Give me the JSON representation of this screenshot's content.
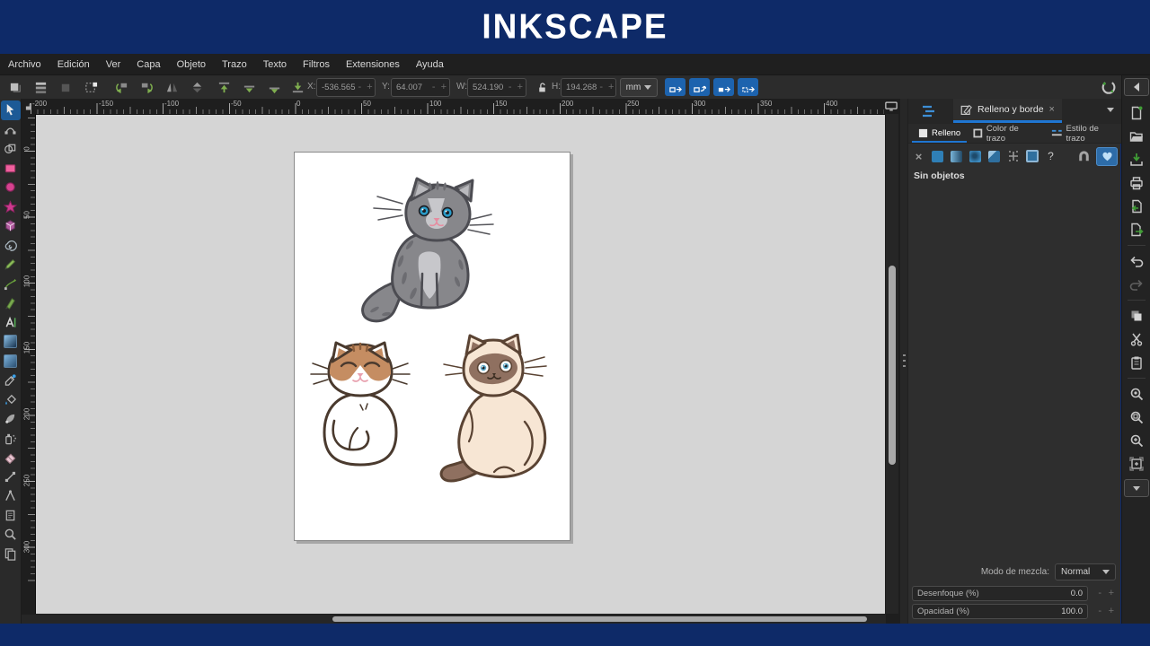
{
  "branding": {
    "logo_text": "INKSCAPE"
  },
  "menu_bar": {
    "items": [
      "Archivo",
      "Edición",
      "Ver",
      "Capa",
      "Objeto",
      "Trazo",
      "Texto",
      "Filtros",
      "Extensiones",
      "Ayuda"
    ]
  },
  "tool_controls": {
    "x_label": "X:",
    "x_value": "-536.565",
    "y_label": "Y:",
    "y_value": "64.007",
    "w_label": "W:",
    "w_value": "524.190",
    "h_label": "H:",
    "h_value": "194.268",
    "units_value": "mm",
    "minus": "-",
    "plus": "+"
  },
  "rulers": {
    "horizontal_labels": [
      "-200",
      "-150",
      "-100",
      "-50",
      "0",
      "50",
      "100",
      "150",
      "200",
      "250",
      "300",
      "350",
      "400"
    ],
    "vertical_labels": [
      "0",
      "50",
      "100",
      "150",
      "200",
      "250",
      "300"
    ]
  },
  "fill_stroke_panel": {
    "dock_tab_title": "Relleno y borde",
    "close_glyph": "×",
    "subtabs": [
      {
        "label": "Relleno"
      },
      {
        "label": "Color de trazo"
      },
      {
        "label": "Estilo de trazo"
      }
    ],
    "paint_none_glyph": "×",
    "paint_unknown_glyph": "?",
    "status_text": "Sin objetos",
    "blend_mode_label": "Modo de mezcla:",
    "blend_mode_value": "Normal",
    "blur_label": "Desenfoque (%)",
    "blur_value": "0.0",
    "opacity_label": "Opacidad (%)",
    "opacity_value": "100.0"
  },
  "colors": {
    "brand_navy": "#0e2a68",
    "accent_blue": "#1f76d2",
    "toolbar_button_blue": "#1d63ae",
    "canvas_gray": "#d5d5d5",
    "page_white": "#ffffff",
    "cat_gray": "#87878b",
    "cat_orange": "#c58d62",
    "cat_cream": "#f7e6d4",
    "cat_point_brown": "#8f7060"
  }
}
